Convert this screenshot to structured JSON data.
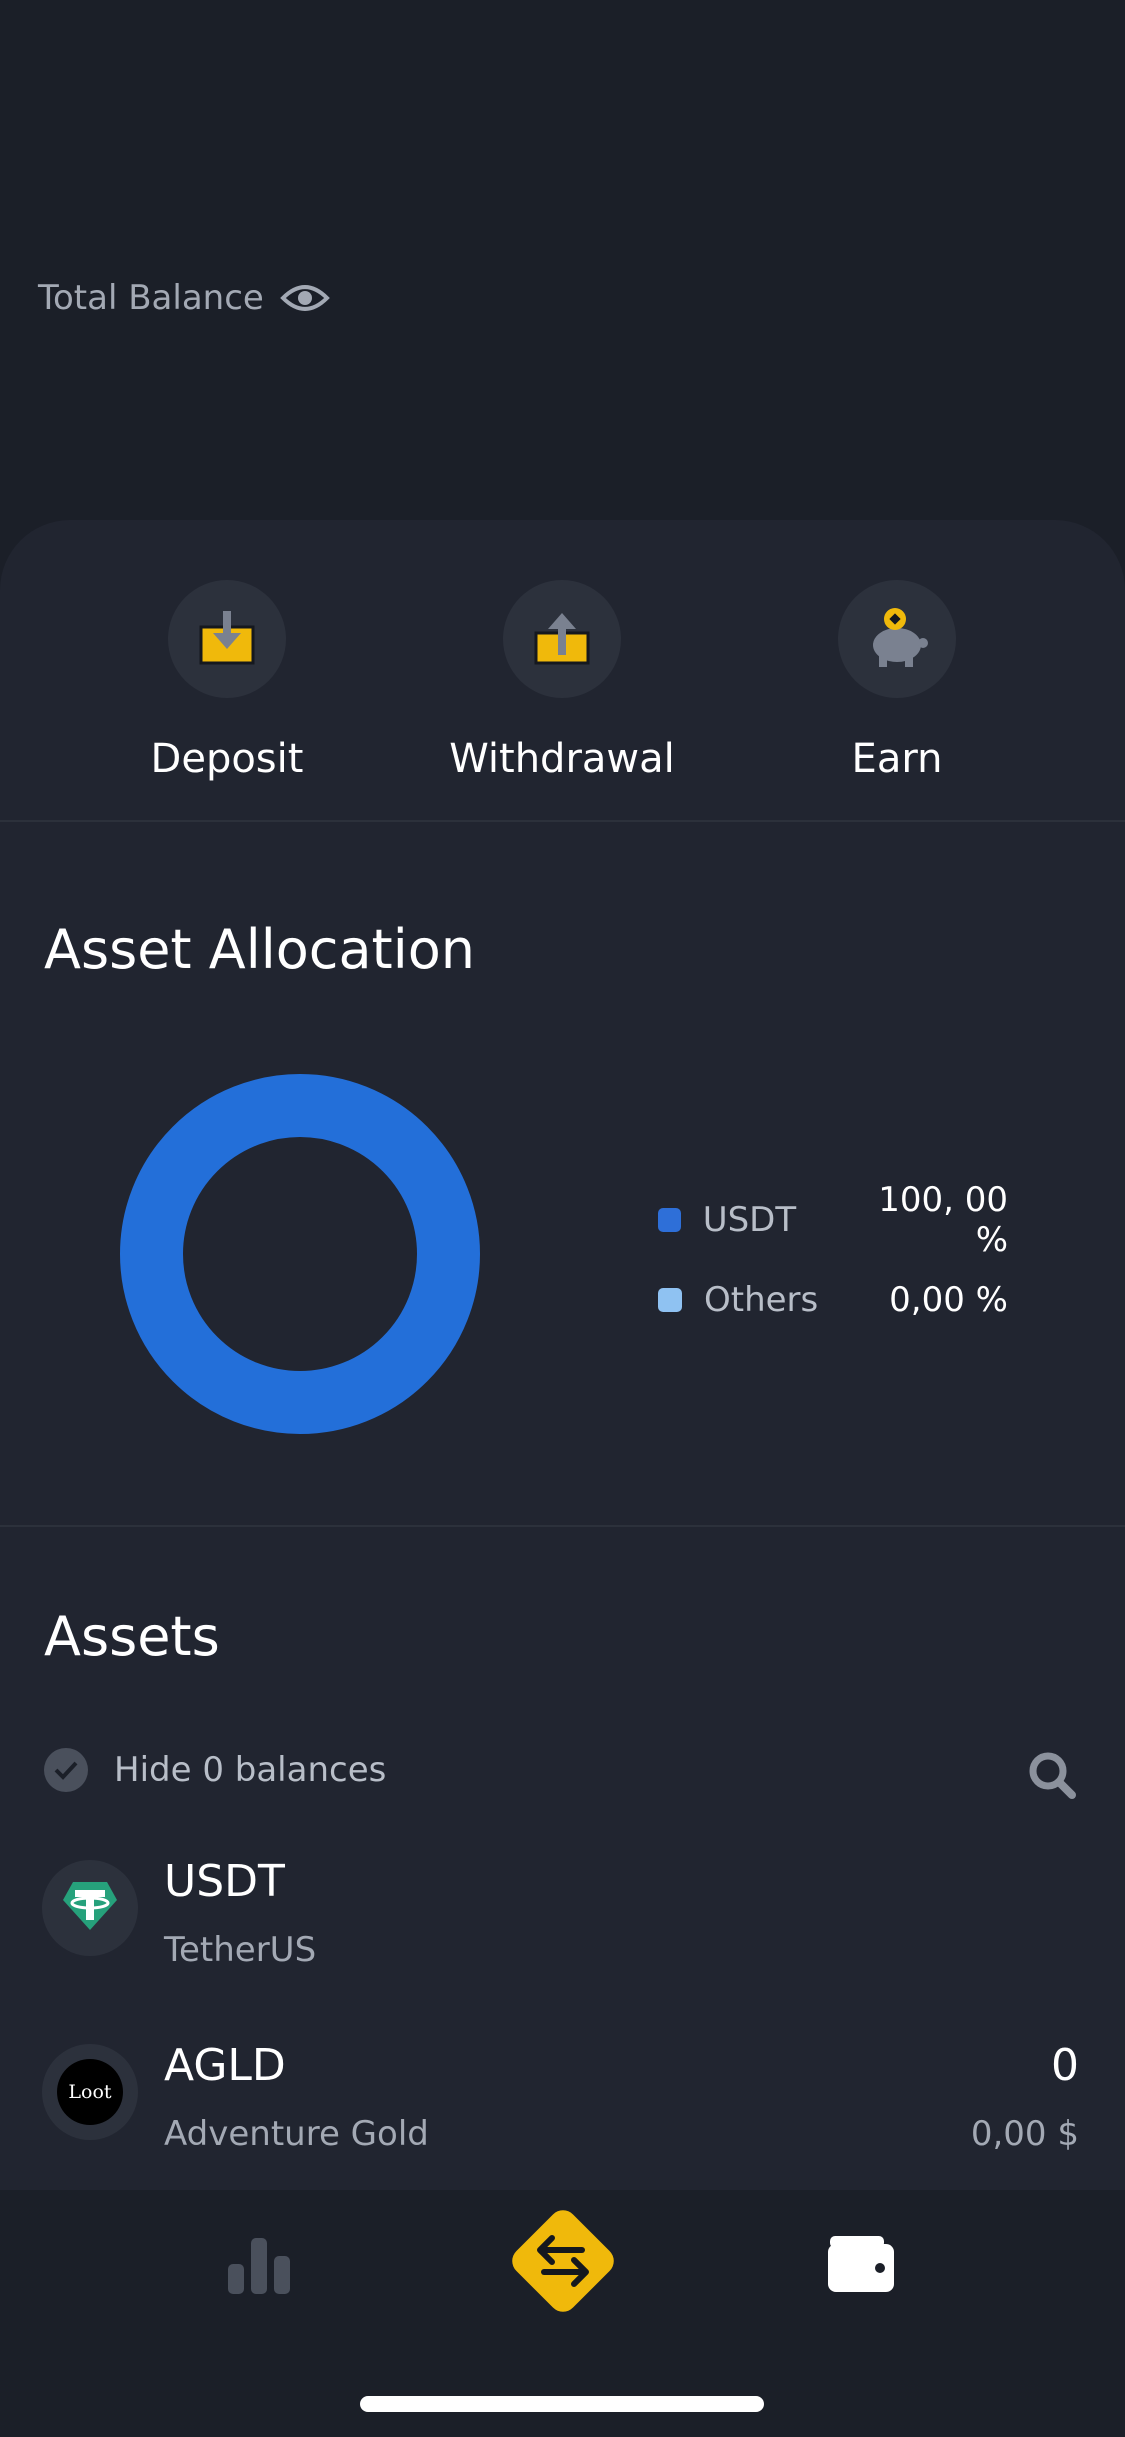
{
  "header": {
    "balance_label": "Total Balance",
    "eye_icon": "eye-icon"
  },
  "actions": [
    {
      "label": "Deposit",
      "icon": "deposit-icon"
    },
    {
      "label": "Withdrawal",
      "icon": "withdrawal-icon"
    },
    {
      "label": "Earn",
      "icon": "piggy-bank-icon"
    }
  ],
  "allocation": {
    "title": "Asset Allocation",
    "legend": [
      {
        "name": "USDT",
        "value": "100, 00 %",
        "color": "#2e6fd8"
      },
      {
        "name": "Others",
        "value": "0,00 %",
        "color": "#8fc2f2"
      }
    ]
  },
  "chart_data": {
    "type": "pie",
    "categories": [
      "USDT",
      "Others"
    ],
    "values": [
      100,
      0
    ],
    "colors": [
      "#236fd9",
      "#8fc2f2"
    ],
    "donut": true,
    "legend_position": "right"
  },
  "assets": {
    "title": "Assets",
    "hide_label": "Hide 0 balances",
    "items": [
      {
        "symbol": "USDT",
        "name": "TetherUS",
        "amount": "",
        "fiat": "",
        "icon": "tether-icon"
      },
      {
        "symbol": "AGLD",
        "name": "Adventure Gold",
        "amount": "0",
        "fiat": "0,00 $",
        "icon": "loot-icon",
        "icon_text": "Loot"
      }
    ]
  },
  "tabbar": {
    "items": [
      {
        "icon": "markets-bar-chart-icon"
      },
      {
        "icon": "trade-swap-icon"
      },
      {
        "icon": "wallet-icon"
      }
    ],
    "accent": "#f0b90b"
  }
}
